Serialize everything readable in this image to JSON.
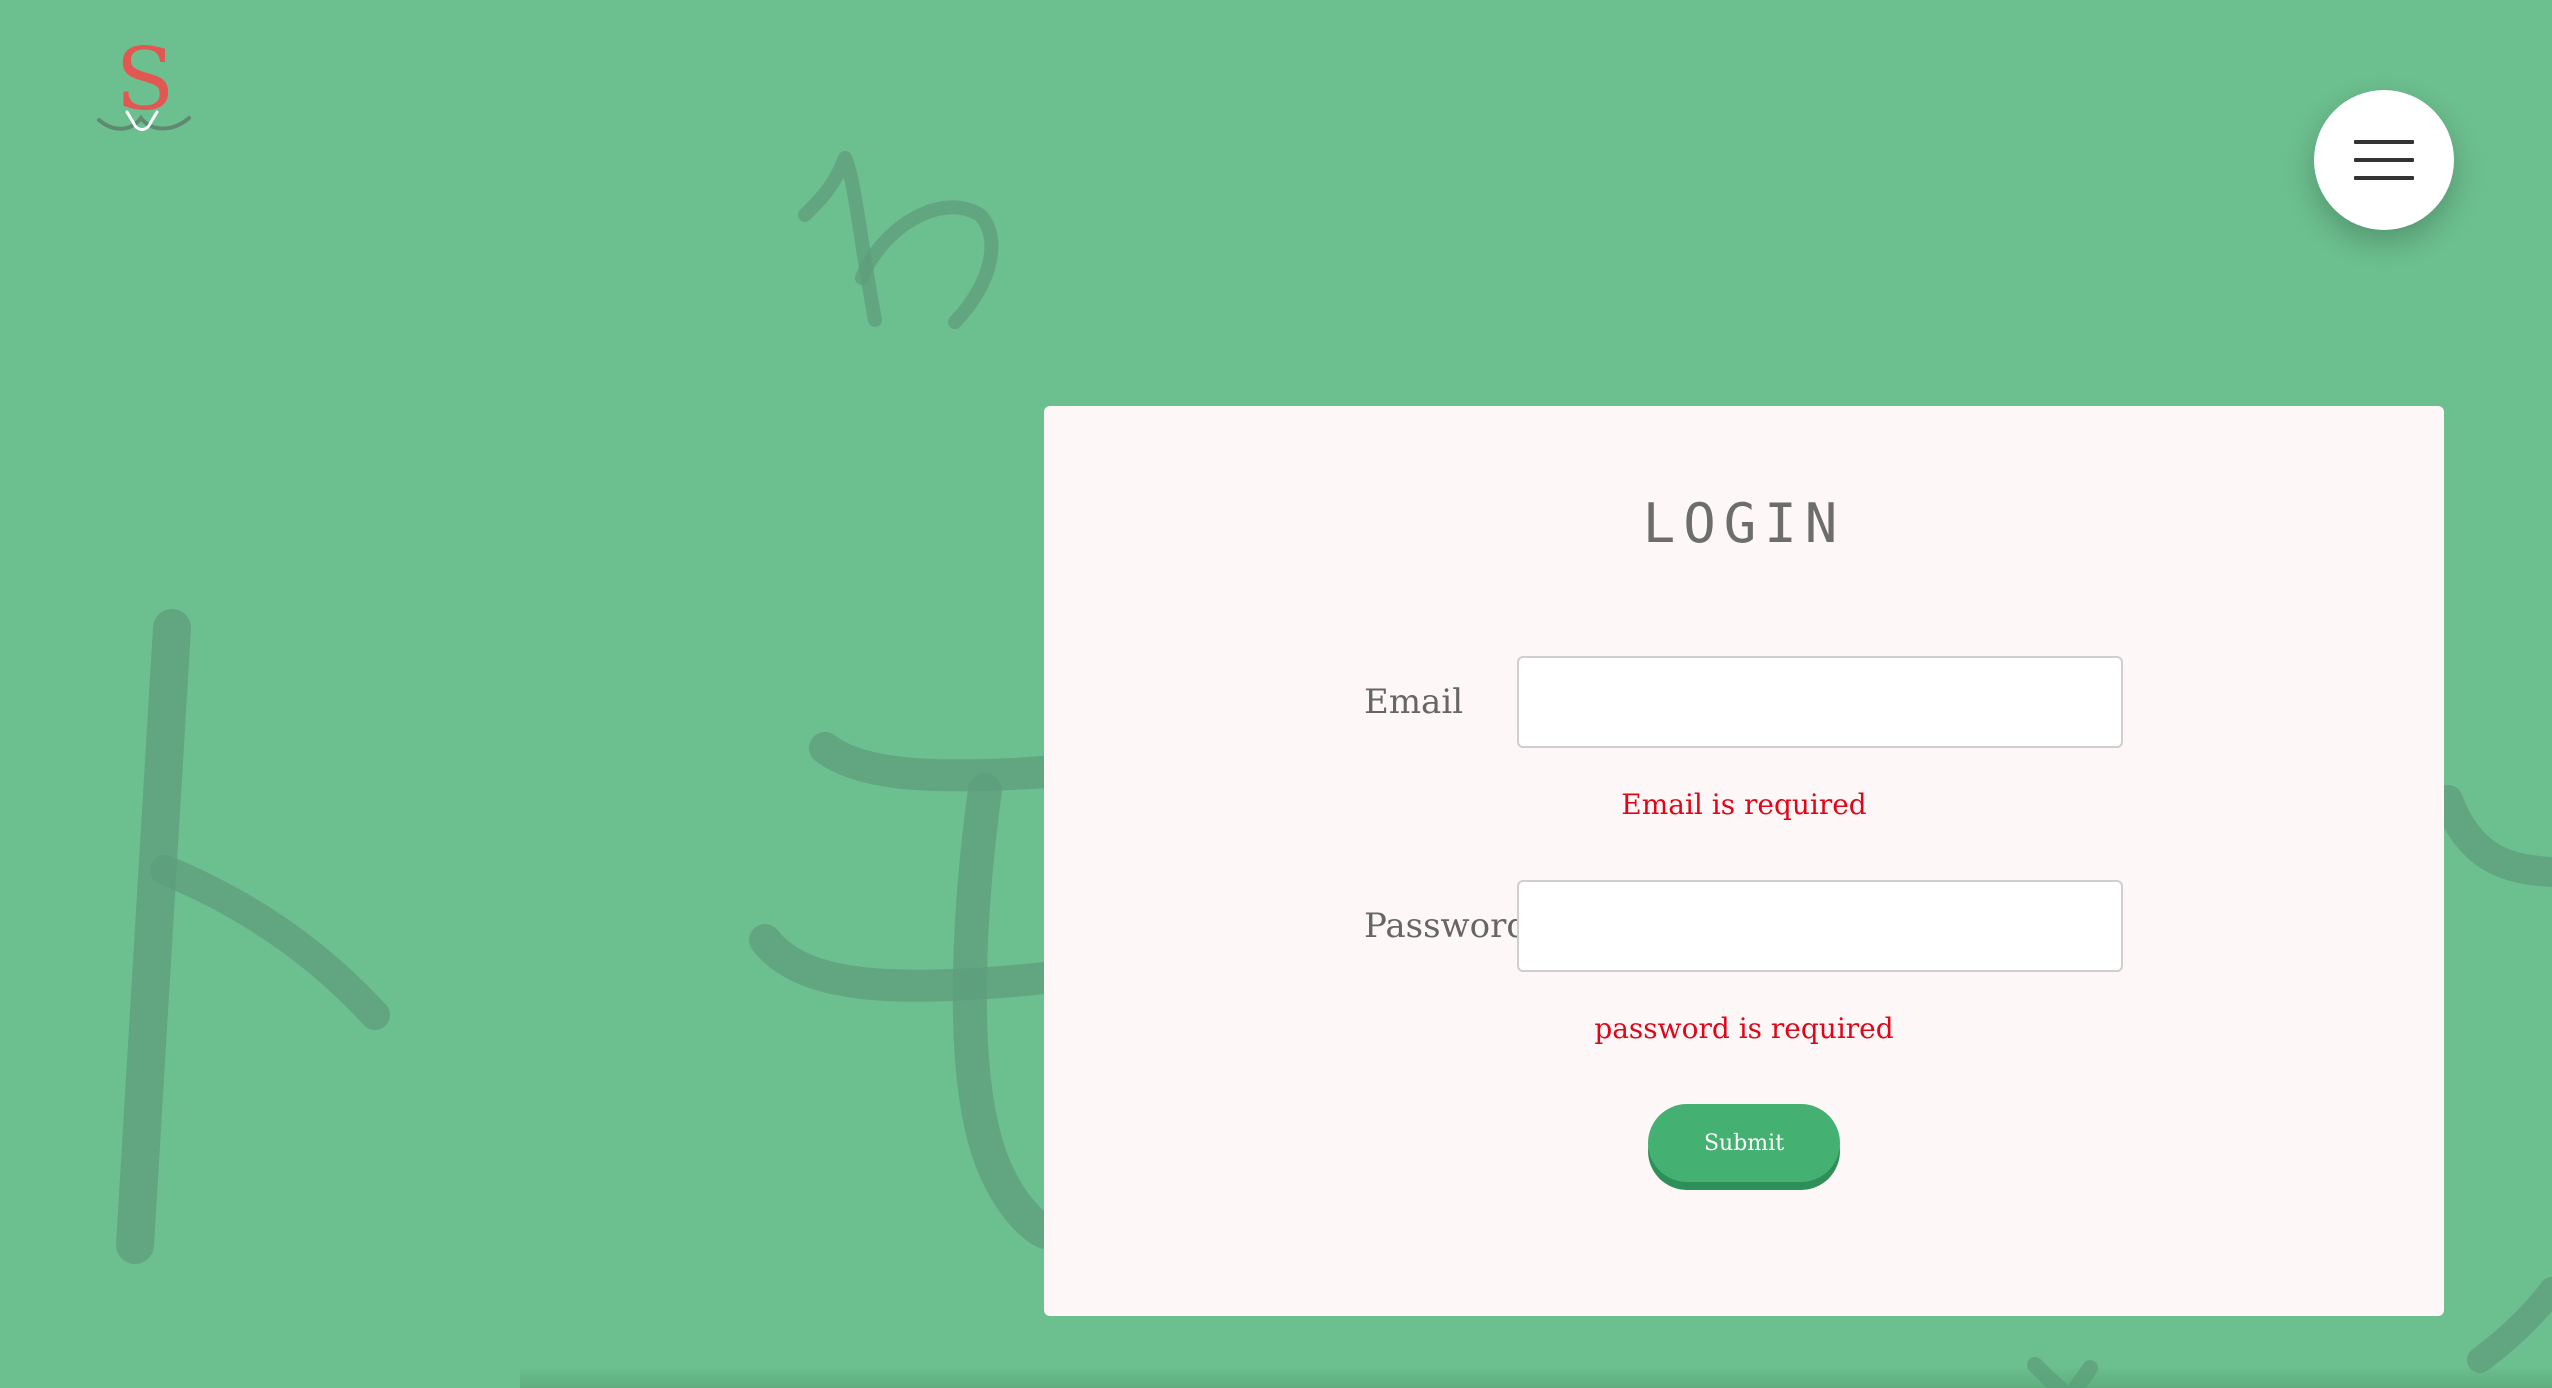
{
  "app": {
    "logo_letter": "S"
  },
  "header": {
    "menu_icon": "hamburger-icon"
  },
  "login": {
    "title": "LOGIN",
    "email_label": "Email",
    "email_value": "",
    "email_error": "Email is required",
    "password_label": "Password",
    "password_value": "",
    "password_error": "password is required",
    "submit_label": "Submit"
  },
  "colors": {
    "background": "#6cbf8f",
    "card": "#fdf8f7",
    "logo": "#e35752",
    "error": "#e0061a",
    "button": "#44b072"
  }
}
